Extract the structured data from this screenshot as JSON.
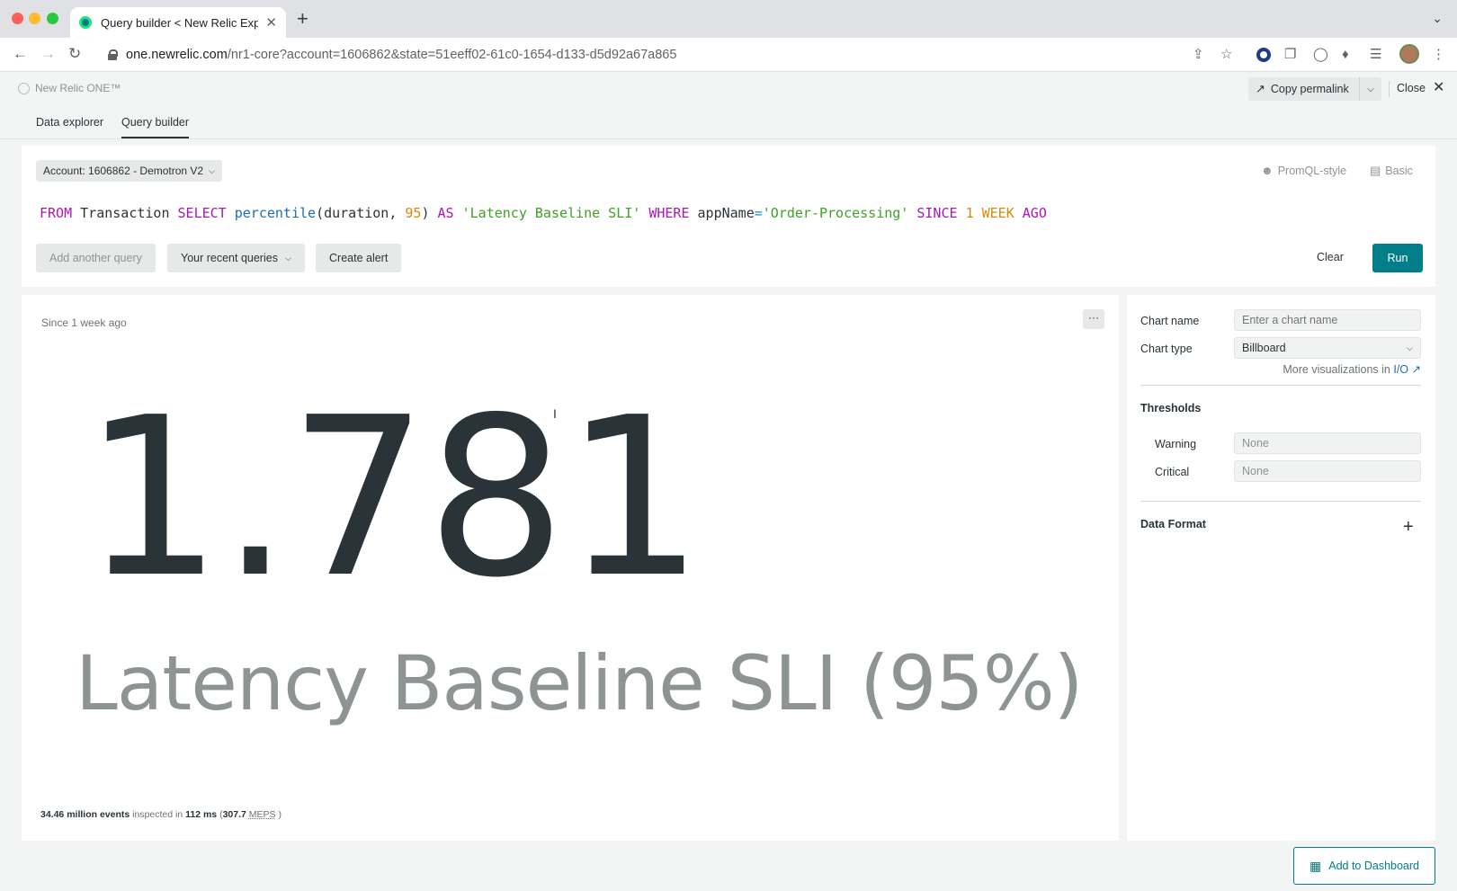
{
  "browser": {
    "tab_title": "Query builder < New Relic Exp",
    "tab_close": "✕",
    "new_tab": "+",
    "tabs_menu": "⌄",
    "url_host": "one.newrelic.com",
    "url_path": "/nr1-core?account=1606862&state=51eeff02-61c0-1654-d133-d5d92a67a865"
  },
  "app": {
    "brand": "New Relic ONE™",
    "copy_permalink": "Copy permalink",
    "close": "Close",
    "tabs": [
      {
        "label": "Data explorer",
        "active": false
      },
      {
        "label": "Query builder",
        "active": true
      }
    ]
  },
  "query": {
    "account": "Account: 1606862 - Demotron V2",
    "mode_promql": "PromQL-style",
    "mode_basic": "Basic",
    "tokens": {
      "from": "FROM",
      "table": "Transaction",
      "select": "SELECT",
      "func": "percentile",
      "args_open": "(duration, ",
      "pct": "95",
      "args_close": ")",
      "as": "AS",
      "alias": "'Latency Baseline SLI'",
      "where": "WHERE",
      "field": "appName",
      "eq": "=",
      "value": "'Order-Processing'",
      "since": "SINCE",
      "one": "1",
      "week": "WEEK",
      "ago": "AGO"
    },
    "add_another": "Add another query",
    "recent": "Your recent queries",
    "create_alert": "Create alert",
    "clear": "Clear",
    "run": "Run"
  },
  "result": {
    "since": "Since 1 week ago",
    "more": "···",
    "value": "1.781",
    "label": "Latency Baseline SLI (95%)",
    "stats": {
      "events": "34.46 million events",
      "inspected_in": "inspected in",
      "ms": "112 ms",
      "open": "(",
      "meps_value": "307.7",
      "meps": "MEPS",
      "close": ")"
    }
  },
  "config": {
    "chart_name_label": "Chart name",
    "chart_name_placeholder": "Enter a chart name",
    "chart_type_label": "Chart type",
    "chart_type_value": "Billboard",
    "more_vis": "More visualizations in",
    "more_vis_link": "I/O",
    "thresholds": "Thresholds",
    "warning_label": "Warning",
    "warning_value": "None",
    "critical_label": "Critical",
    "critical_value": "None",
    "data_format": "Data Format",
    "plus": "+"
  },
  "add_to_dashboard": "Add to Dashboard",
  "colors": {
    "accent": "#007e8a",
    "keyword": "#a918b4",
    "function": "#1d6db5",
    "number": "#d58a06",
    "string": "#3ea025"
  }
}
